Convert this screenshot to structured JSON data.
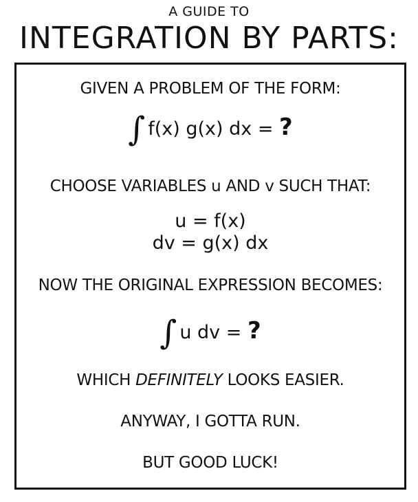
{
  "header": {
    "small": "A GUIDE TO",
    "title": "INTEGRATION BY PARTS:"
  },
  "panel": {
    "intro": "GIVEN A PROBLEM OF THE FORM:",
    "formula1": {
      "integral": "∫",
      "body": "f(x) g(x) dx = ",
      "question": "?"
    },
    "choose": "CHOOSE VARIABLES u AND v SUCH THAT:",
    "u_def": "u = f(x)",
    "dv_def": "dv = g(x) dx",
    "becomes": "NOW THE ORIGINAL EXPRESSION BECOMES:",
    "formula2": {
      "integral": "∫",
      "body": "u dv = ",
      "question": "?"
    },
    "easier": {
      "pre": "WHICH ",
      "emph": "DEFINITELY",
      "post": " LOOKS EASIER."
    },
    "run": "ANYWAY, I GOTTA RUN.",
    "luck": "BUT GOOD LUCK!"
  }
}
